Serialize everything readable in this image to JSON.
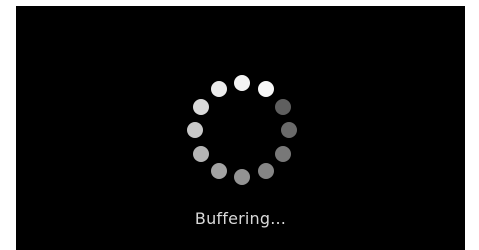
{
  "player": {
    "status_text": "Buffering..."
  },
  "spinner": {
    "icon": "loading-spinner-icon",
    "dot_count": 12,
    "dot_colors": [
      "#f4f4f4",
      "#f7f7f7",
      "#5f5f5f",
      "#6a6a6a",
      "#787878",
      "#858585",
      "#939393",
      "#a3a3a3",
      "#b5b5b5",
      "#c8c8c8",
      "#dadada",
      "#ececec"
    ]
  },
  "colors": {
    "background": "#000000",
    "text": "#d9d9d9"
  }
}
